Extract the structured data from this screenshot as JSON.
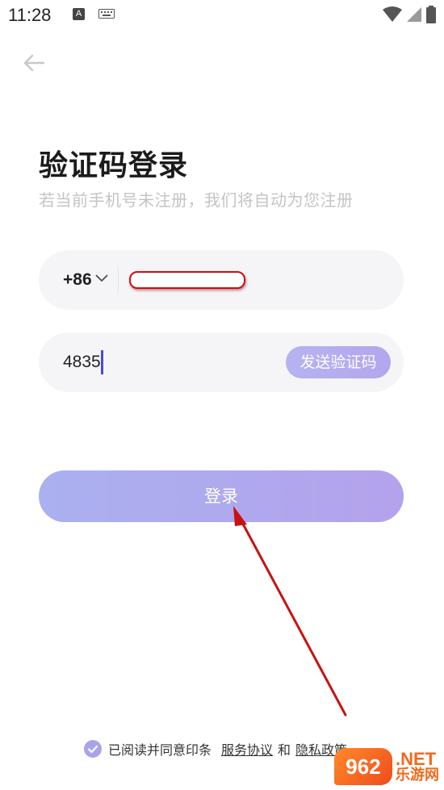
{
  "status_bar": {
    "time": "11:28",
    "indicator_a": "A",
    "icons": [
      "keyboard-icon",
      "wifi-icon",
      "signal-icon",
      "battery-icon"
    ]
  },
  "header": {
    "title": "验证码登录",
    "subtitle": "若当前手机号未注册，我们将自动为您注册"
  },
  "phone_field": {
    "country_code": "+86",
    "value": ""
  },
  "code_field": {
    "value": "4835",
    "send_code_label": "发送验证码"
  },
  "login_button": {
    "label": "登录"
  },
  "agreement": {
    "checked": true,
    "text": "已阅读并同意印条",
    "service_link": "服务协议",
    "and_text": "和",
    "privacy_link": "隐私政策"
  },
  "watermark": {
    "logo_text": "962",
    "suffix": ".NET",
    "site_name": "乐游网"
  },
  "colors": {
    "accent_start": "#aab0f0",
    "accent_end": "#b4a2ec",
    "field_bg": "#f5f5f8",
    "annotation": "#c81212"
  }
}
